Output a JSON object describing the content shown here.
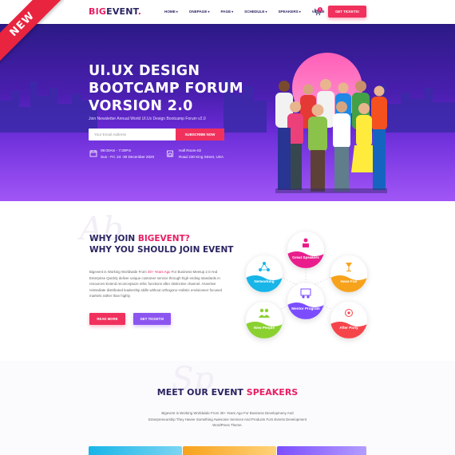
{
  "ribbon": {
    "label": "NEW"
  },
  "header": {
    "logo_part1": "BIG",
    "logo_part2": "EVENT",
    "logo_dot": ".",
    "nav": [
      {
        "label": "HOME"
      },
      {
        "label": "ONEPAGE"
      },
      {
        "label": "PAGE"
      },
      {
        "label": "SCHEDULE"
      },
      {
        "label": "SPEAKERS"
      },
      {
        "label": "VENUE"
      }
    ],
    "cart_count": "0",
    "tickets_label": "GET TICKETS!"
  },
  "hero": {
    "title_line1": "UI.UX DESIGN",
    "title_line2": "BOOTCAMP FORUM",
    "title_line3": "VORSION 2.0",
    "subtitle": "Join Newsletter Annual World UI.Ux Design Bootcamp Forum v2.0",
    "email_placeholder": "Your Email Address",
    "subscribe_label": "SUBSCRIBE NOW",
    "time_line1": "09:00Am - 7:30Pm",
    "time_line2": "Sun - Fri. 24 -30 December 2020",
    "venue_line1": "Hall Room-02",
    "venue_line2": "Road 230 King Street, USA"
  },
  "about": {
    "watermark": "Ab",
    "title_prefix": "WHY JOIN ",
    "title_highlight": "BIGEVENT?",
    "title_line2": "WHY YOU SHOULD JOIN EVENT",
    "text_before": "Bigevent is Working Worldwide From ",
    "text_highlight": "30+ Years Ago",
    "text_after": " For Business Meetup 2.0 And Enterprise Quickly deliver unique customer service through high ending standards in resources Extend reconceptuze ethic functions after distinctive channel. Assertive reintediate distributed leadership skills without orthogono Holistic envisioneer focused markets rather than highly.",
    "read_more_label": "READ MORE",
    "get_tickets_label": "GET TICKETS!",
    "features": [
      {
        "label": "Great Speakers",
        "color": "#e91e8c"
      },
      {
        "label": "Networking",
        "color": "#17b5e8"
      },
      {
        "label": "Have Fun",
        "color": "#f7a21b"
      },
      {
        "label": "Mentor Program",
        "color": "#7c4dff"
      },
      {
        "label": "New People",
        "color": "#8ad130"
      },
      {
        "label": "After Party",
        "color": "#f5454b"
      }
    ]
  },
  "speakers": {
    "watermark": "Sp",
    "title_prefix": "MEET OUR EVENT ",
    "title_highlight": "SPEAKERS",
    "text": "Bigevent is Working Worldwide From 30+ Years Ago For Business Developmeny And Enterpreneurship They Havee Something Awesome Services And Products Fors Events Development WordPress Theme."
  },
  "colors": {
    "brand_pink": "#f0315d",
    "brand_navy": "#2a2461",
    "brand_purple": "#8c55f0"
  }
}
